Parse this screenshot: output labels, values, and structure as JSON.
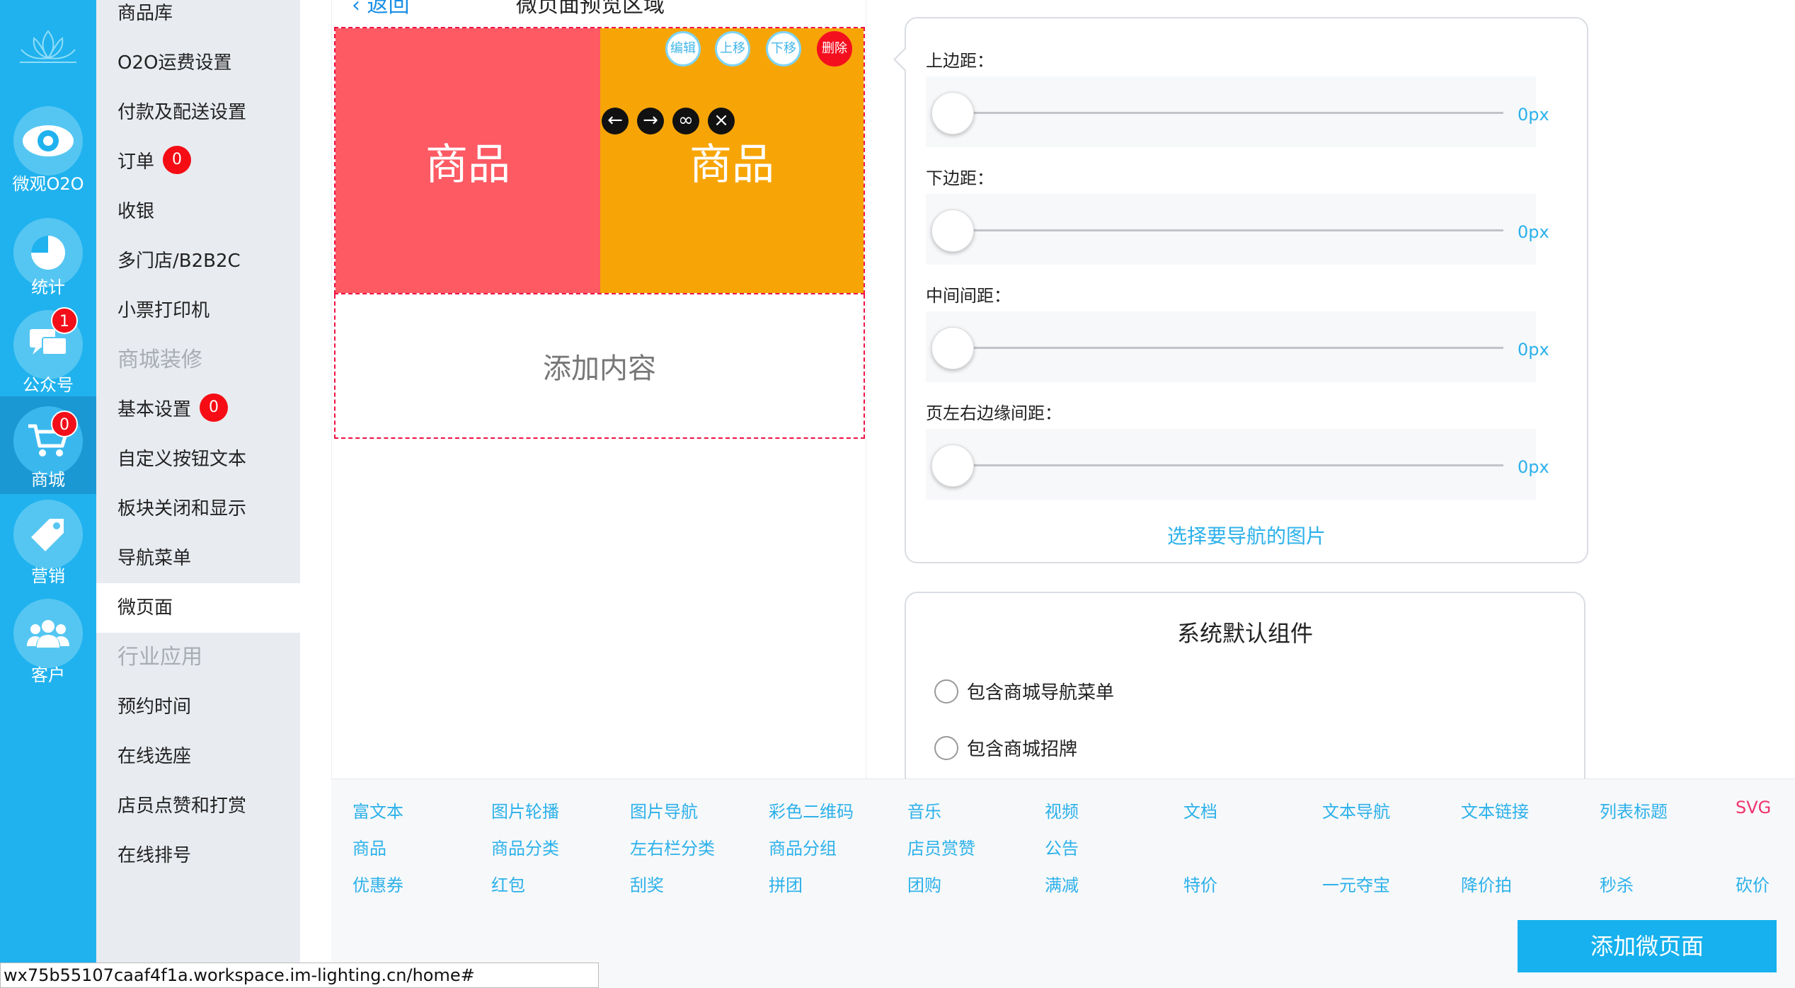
{
  "rail": {
    "items": [
      {
        "label": "微观O2O",
        "icon": "eye-icon"
      },
      {
        "label": "统计",
        "icon": "pie-chart-icon"
      },
      {
        "label": "公众号",
        "icon": "chat-icon",
        "badge": "1"
      },
      {
        "label": "商城",
        "icon": "cart-icon",
        "badge": "0"
      },
      {
        "label": "营销",
        "icon": "tag-icon"
      },
      {
        "label": "客户",
        "icon": "users-icon"
      }
    ]
  },
  "menu": {
    "items": [
      {
        "label": "商品库"
      },
      {
        "label": "O2O运费设置"
      },
      {
        "label": "付款及配送设置"
      },
      {
        "label": "订单",
        "badge": "0"
      },
      {
        "label": "收银"
      },
      {
        "label": "多门店/B2B2C"
      },
      {
        "label": "小票打印机"
      },
      {
        "label": "商城装修"
      },
      {
        "label": "基本设置",
        "badge": "0"
      },
      {
        "label": "自定义按钮文本"
      },
      {
        "label": "板块关闭和显示"
      },
      {
        "label": "导航菜单"
      },
      {
        "label": "微页面"
      },
      {
        "label": "行业应用"
      },
      {
        "label": "预约时间"
      },
      {
        "label": "在线选座"
      },
      {
        "label": "店员点赞和打赏"
      },
      {
        "label": "在线排号"
      }
    ]
  },
  "preview": {
    "back": "返回",
    "title": "微页面预览区域",
    "tile_left": "商品",
    "tile_right": "商品",
    "actions": {
      "edit": "编辑",
      "up": "上移",
      "down": "下移",
      "delete": "删除"
    },
    "add_content": "添加内容"
  },
  "settings": {
    "sliders": [
      {
        "label": "上边距：",
        "value": "0px"
      },
      {
        "label": "下边距：",
        "value": "0px"
      },
      {
        "label": "中间间距：",
        "value": "0px"
      },
      {
        "label": "页左右边缘间距：",
        "value": "0px"
      }
    ],
    "choose_link": "选择要导航的图片"
  },
  "defaults": {
    "title": "系统默认组件",
    "options": [
      "包含商城导航菜单",
      "包含商城招牌"
    ]
  },
  "palette": {
    "rows": [
      [
        "富文本",
        "图片轮播",
        "图片导航",
        "彩色二维码",
        "音乐",
        "视频",
        "文档",
        "文本导航",
        "文本链接",
        "列表标题",
        "SVG"
      ],
      [
        "商品",
        "商品分类",
        "左右栏分类",
        "商品分组",
        "店员赏赞",
        "公告"
      ],
      [
        "优惠券",
        "红包",
        "刮奖",
        "拼团",
        "团购",
        "满减",
        "特价",
        "一元夺宝",
        "降价拍",
        "秒杀",
        "砍价"
      ]
    ]
  },
  "add_page_button": "添加微页面",
  "status_url": "wx75b55107caaf4f1a.workspace.im-lighting.cn/home#"
}
